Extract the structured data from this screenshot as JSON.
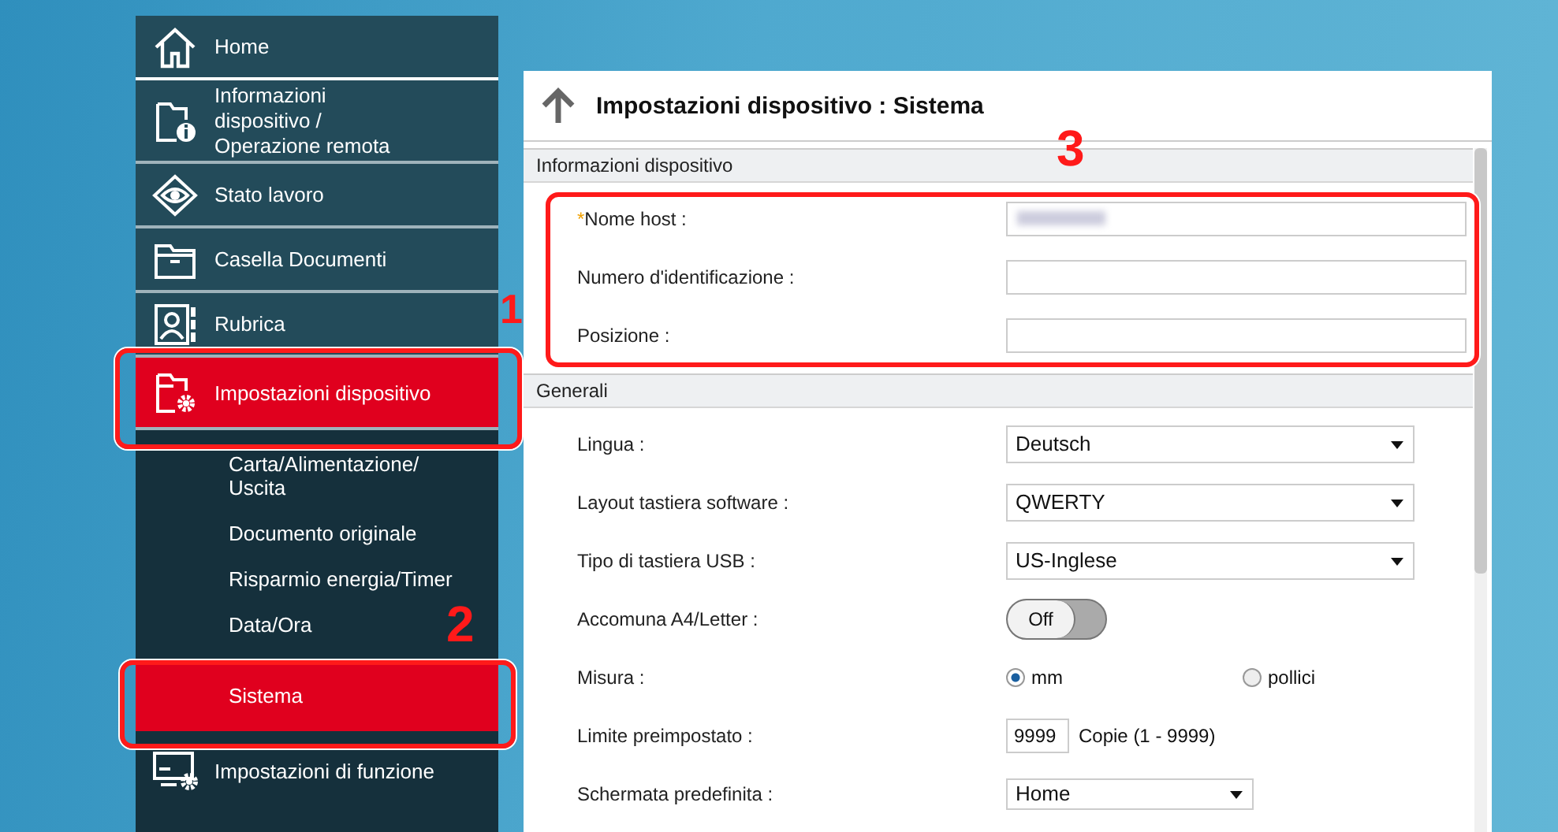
{
  "sidebar": {
    "items": [
      {
        "label": "Home",
        "selected": false
      },
      {
        "label": "Informazioni dispositivo / Operazione remota",
        "selected": false
      },
      {
        "label": "Stato lavoro",
        "selected": false
      },
      {
        "label": "Casella Documenti",
        "selected": false
      },
      {
        "label": "Rubrica",
        "selected": false
      },
      {
        "label": "Impostazioni dispositivo",
        "selected": true,
        "children": [
          {
            "label": "Carta/Alimentazione/ Uscita",
            "selected": false
          },
          {
            "label": "Documento originale",
            "selected": false
          },
          {
            "label": "Risparmio energia/Timer",
            "selected": false
          },
          {
            "label": "Data/Ora",
            "selected": false
          },
          {
            "label": "Sistema",
            "selected": true
          }
        ]
      },
      {
        "label": "Impostazioni di funzione",
        "selected": false
      }
    ]
  },
  "panel": {
    "title": "Impostazioni dispositivo : Sistema",
    "sections": [
      {
        "title": "Informazioni dispositivo",
        "rows": [
          {
            "kind": "text",
            "mark": "*",
            "label": "Nome host :",
            "blurred": true
          },
          {
            "kind": "text",
            "label": "Numero d'identificazione :",
            "blurred": false
          },
          {
            "kind": "text",
            "label": "Posizione :",
            "blurred": false
          }
        ]
      },
      {
        "title": "Generali",
        "rows": [
          {
            "kind": "select",
            "label": "Lingua :",
            "value": "Deutsch"
          },
          {
            "kind": "select",
            "label": "Layout tastiera software :",
            "value": "QWERTY"
          },
          {
            "kind": "select",
            "label": "Tipo di tastiera USB :",
            "value": "US-Inglese"
          },
          {
            "kind": "toggle",
            "label": "Accomuna A4/Letter :",
            "on": false,
            "state_label": "Off"
          },
          {
            "kind": "radio",
            "label": "Misura :",
            "options": [
              {
                "label": "mm",
                "selected": true
              },
              {
                "label": "pollici",
                "selected": false
              }
            ]
          },
          {
            "kind": "number",
            "label": "Limite preimpostato :",
            "value": "9999",
            "suffix": "Copie (1 - 9999)"
          },
          {
            "kind": "select",
            "label": "Schermata predefinita :",
            "value": "Home"
          }
        ]
      }
    ]
  },
  "callouts": [
    "1",
    "2",
    "3"
  ]
}
